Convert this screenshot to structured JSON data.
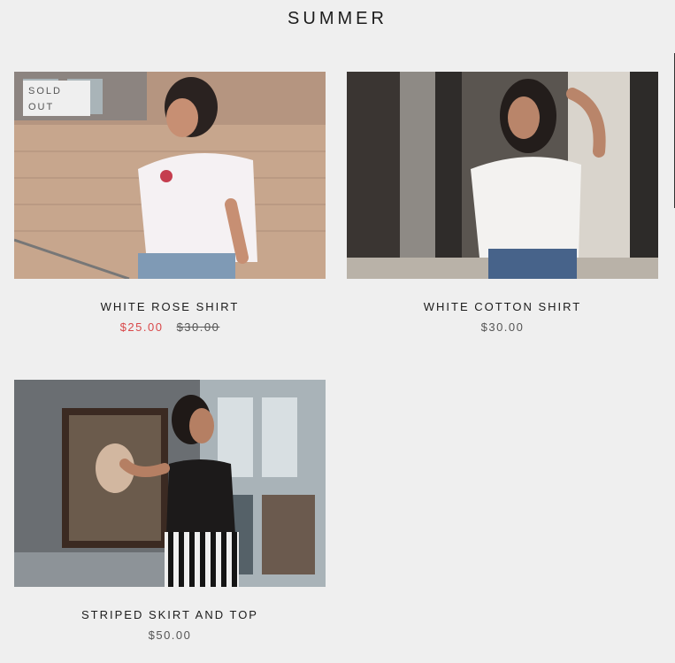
{
  "collection": {
    "title": "SUMMER"
  },
  "products": [
    {
      "name": "WHITE ROSE SHIRT",
      "badge": "SOLD OUT",
      "sale_price": "$25.00",
      "compare_price": "$30.00"
    },
    {
      "name": "WHITE COTTON SHIRT",
      "price": "$30.00"
    },
    {
      "name": "STRIPED SKIRT AND TOP",
      "price": "$50.00"
    }
  ],
  "colors": {
    "background": "#efefef",
    "sale": "#d9484a",
    "text": "#1c1c1c",
    "muted": "#555555"
  }
}
